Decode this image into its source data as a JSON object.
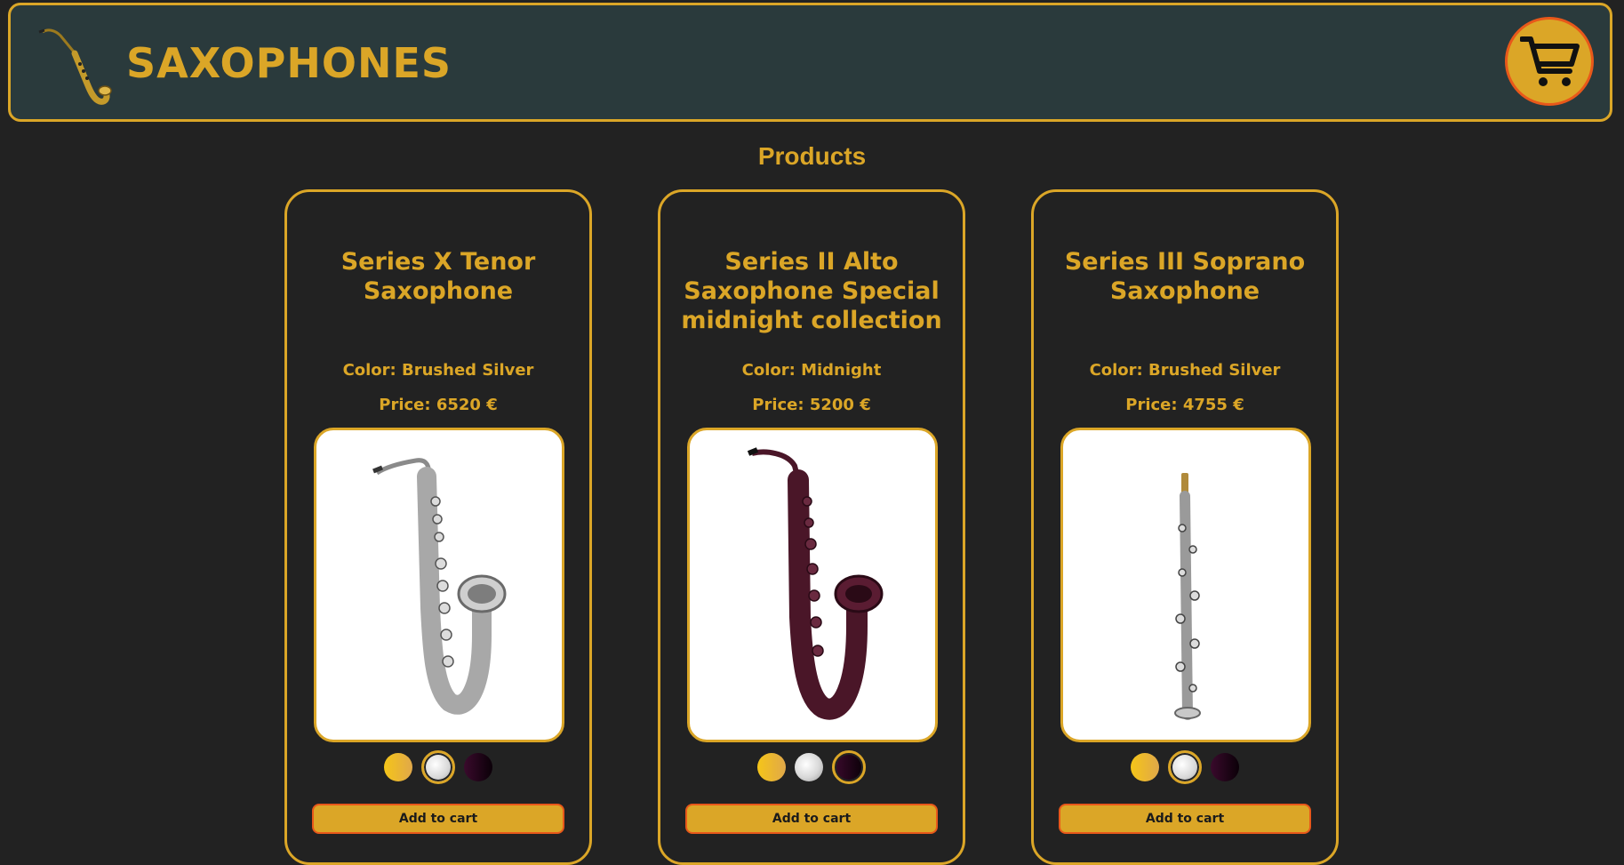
{
  "header": {
    "brand": "SAXOPHONES",
    "logo_icon": "saxophone-logo-icon",
    "cart_icon": "shopping-cart-icon"
  },
  "main": {
    "title": "Products",
    "products": [
      {
        "name": "Series X Tenor Saxophone",
        "color": "Color: Brushed Silver",
        "price": "Price: 6520 €",
        "selected_swatch": "silver",
        "add_label": "Add to cart"
      },
      {
        "name": "Series II Alto Saxophone Special midnight collection",
        "color": "Color: Midnight",
        "price": "Price: 5200 €",
        "selected_swatch": "midnight",
        "add_label": "Add to cart"
      },
      {
        "name": "Series III Soprano Saxophone",
        "color": "Color: Brushed Silver",
        "price": "Price: 4755 €",
        "selected_swatch": "silver",
        "add_label": "Add to cart"
      }
    ],
    "swatch_options": [
      "gold",
      "silver",
      "midnight"
    ]
  },
  "colors": {
    "accent": "#dba627",
    "header_bg": "#2a3a3c",
    "page_bg": "#222222",
    "cart_border": "#e8581a",
    "midnight_instrument": "#4a1628",
    "silver_instrument": "#b8b8b8"
  }
}
